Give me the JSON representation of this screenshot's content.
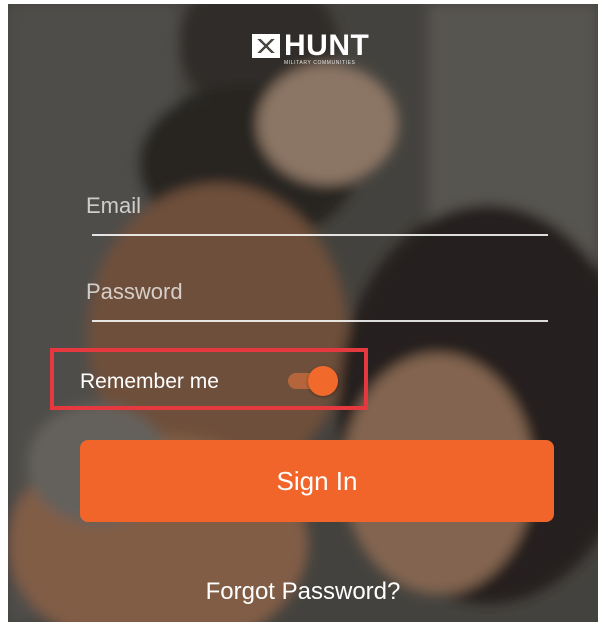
{
  "brand": {
    "logo_word": "HUNT",
    "logo_tagline": "MILITARY COMMUNITIES"
  },
  "login": {
    "email_placeholder": "Email",
    "password_placeholder": "Password",
    "remember_label": "Remember me",
    "remember_on": true,
    "signin_label": "Sign In",
    "forgot_label": "Forgot Password?"
  },
  "colors": {
    "accent": "#f2652a",
    "highlight_border": "#e5383f"
  }
}
